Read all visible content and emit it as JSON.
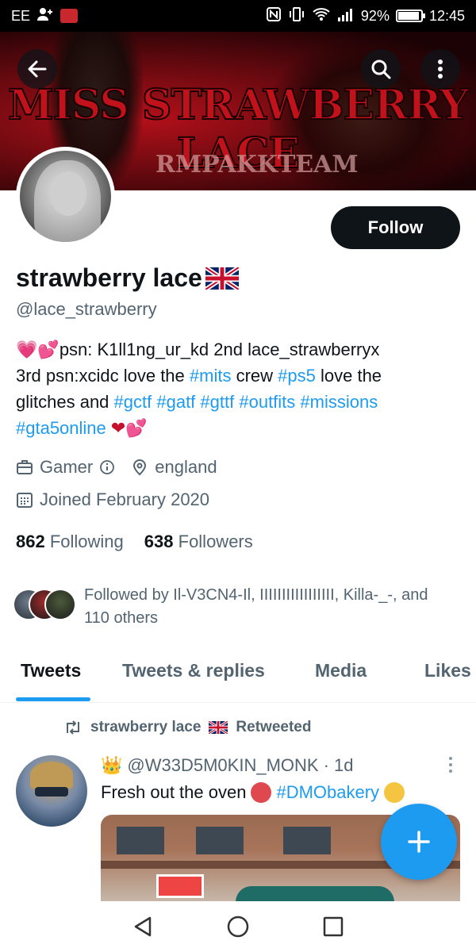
{
  "status_bar": {
    "carrier": "EE",
    "battery": "92%",
    "time": "12:45"
  },
  "banner": {
    "title": "MISS STRAWBERRY LACE",
    "subtitle": "RMPAKKTEAM"
  },
  "profile": {
    "display_name": "strawberry lace",
    "handle": "@lace_strawberry",
    "follow_label": "Follow",
    "bio": {
      "line1_pre": "psn: K1ll1ng_ur_kd 2nd lace_strawberryx",
      "line2_pre": "3rd psn:xcidc love the ",
      "tag_mits": "#mits",
      "crew": " crew ",
      "tag_ps5": "#ps5",
      "love_the": " love the",
      "glitches": "glitches and ",
      "tag_gctf": "#gctf",
      "tag_gatf": "#gatf",
      "tag_gttf": "#gttf",
      "tag_outfits": "#outfits",
      "tag_missions": "#missions",
      "tag_gta5online": "#gta5online"
    },
    "category": "Gamer",
    "location": "england",
    "joined": "Joined February 2020",
    "following_count": "862",
    "following_label": "Following",
    "followers_count": "638",
    "followers_label": "Followers",
    "followed_by": "Followed by Il-V3CN4-Il, IIIIIIIIIIIIIIIII, Killa-_-, and 110 others"
  },
  "tabs": [
    {
      "label": "Tweets",
      "active": true
    },
    {
      "label": "Tweets & replies",
      "active": false
    },
    {
      "label": "Media",
      "active": false
    },
    {
      "label": "Likes",
      "active": false
    }
  ],
  "tweet": {
    "retweet_label": "strawberry lace",
    "retweet_suffix": "Retweeted",
    "author": "@W33D5M0KIN_MONK",
    "time": "· 1d",
    "text_pre": "Fresh out the oven",
    "hashtag": "#DMObakery"
  },
  "colors": {
    "accent": "#1d9bf0",
    "text": "#0f1419",
    "muted": "#536471"
  }
}
